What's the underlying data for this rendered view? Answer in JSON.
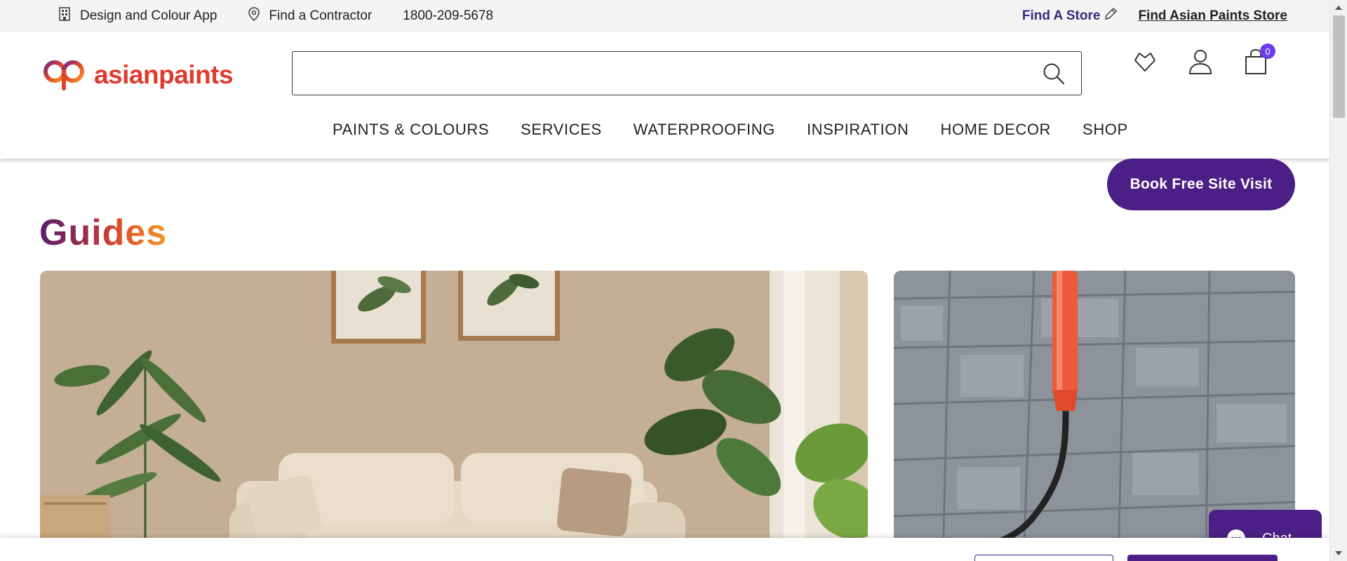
{
  "topbar": {
    "design_app": "Design and Colour App",
    "find_contractor": "Find a Contractor",
    "phone": "1800-209-5678",
    "find_a_store": "Find A Store",
    "find_asian_paints_store": "Find Asian Paints Store"
  },
  "header": {
    "logo_text": "asianpaints",
    "search_placeholder": "",
    "cart_count": "0",
    "nav": [
      {
        "label": "PAINTS & COLOURS"
      },
      {
        "label": "SERVICES"
      },
      {
        "label": "WATERPROOFING"
      },
      {
        "label": "INSPIRATION"
      },
      {
        "label": "HOME DECOR"
      },
      {
        "label": "SHOP"
      }
    ]
  },
  "cta": {
    "book_visit": "Book Free Site Visit"
  },
  "guides": {
    "title": "Guides"
  },
  "chat": {
    "label": "Chat"
  },
  "colors": {
    "brand_purple": "#4b1f85",
    "logo_red": "#e03a2f",
    "cart_badge": "#6a3de8",
    "topbar_bg": "#f4f4f4"
  },
  "icons": {
    "design_app": "building-icon",
    "find_contractor": "location-pin-icon",
    "find_store": "pencil-icon",
    "search": "search-icon",
    "wishlist": "heart-icon",
    "account": "user-icon",
    "cart": "shopping-bag-icon",
    "chat": "chat-bubble-icon"
  }
}
